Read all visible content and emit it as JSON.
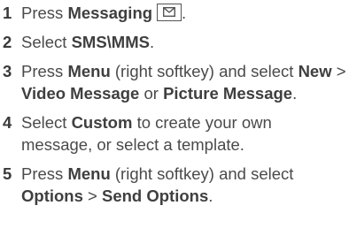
{
  "steps": [
    {
      "num": "1",
      "parts": [
        {
          "t": "Press ",
          "b": false
        },
        {
          "t": "Messaging",
          "b": true
        }
      ],
      "icon": "messaging-envelope-icon",
      "trail": "."
    },
    {
      "num": "2",
      "parts": [
        {
          "t": "Select ",
          "b": false
        },
        {
          "t": "SMS\\MMS",
          "b": true
        },
        {
          "t": ".",
          "b": false
        }
      ]
    },
    {
      "num": "3",
      "parts": [
        {
          "t": "Press ",
          "b": false
        },
        {
          "t": "Menu",
          "b": true
        },
        {
          "t": " (right softkey) and select ",
          "b": false
        },
        {
          "t": "New",
          "b": true
        },
        {
          "t": " > ",
          "b": false
        },
        {
          "t": "Video Message",
          "b": true
        },
        {
          "t": " or ",
          "b": false
        },
        {
          "t": "Picture Message",
          "b": true
        },
        {
          "t": ".",
          "b": false
        }
      ]
    },
    {
      "num": "4",
      "parts": [
        {
          "t": "Select ",
          "b": false
        },
        {
          "t": "Custom",
          "b": true
        },
        {
          "t": " to create your own message, or select a template.",
          "b": false
        }
      ]
    },
    {
      "num": "5",
      "parts": [
        {
          "t": "Press ",
          "b": false
        },
        {
          "t": "Menu",
          "b": true
        },
        {
          "t": " (right softkey) and select ",
          "b": false
        },
        {
          "t": "Options",
          "b": true
        },
        {
          "t": " > ",
          "b": false
        },
        {
          "t": "Send Options",
          "b": true
        },
        {
          "t": ".",
          "b": false
        }
      ]
    }
  ]
}
